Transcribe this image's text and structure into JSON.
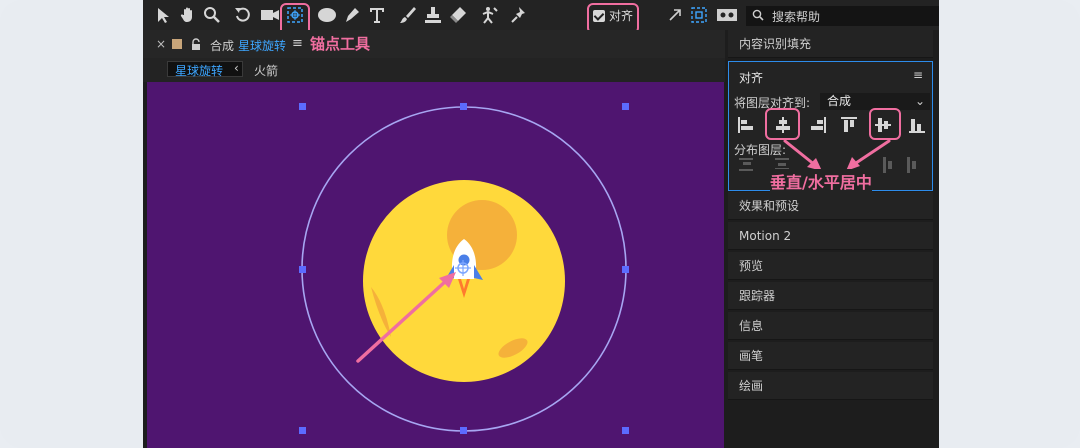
{
  "toolbar": {
    "align_checkbox_label": "对齐",
    "search_label": "搜索帮助",
    "tools": [
      "arrow-icon",
      "hand-icon",
      "zoom-icon",
      "rotate-icon",
      "camera-icon",
      "anchor-point-icon",
      "ellipse-icon",
      "pen-icon",
      "type-icon",
      "brush-icon",
      "clone-stamp-icon",
      "eraser-icon",
      "roto-brush-icon",
      "pin-icon"
    ]
  },
  "composition": {
    "close_glyph": "×",
    "prefix": "合成",
    "name": "星球旋转",
    "menu_glyph": "≡",
    "tabs": [
      "星球旋转",
      "火箭"
    ],
    "tab_arrow": "‹"
  },
  "annotations": {
    "anchor_tool": "锚点工具",
    "align_center": "垂直/水平居中"
  },
  "right_panel": {
    "content_aware_fill": "内容识别填充",
    "align": {
      "title": "对齐",
      "menu_glyph": "≡",
      "align_layers_to_label": "将图层对齐到:",
      "align_target": "合成",
      "distribute_label": "分布图层:"
    },
    "items": [
      "效果和预设",
      "Motion 2",
      "预览",
      "跟踪器",
      "信息",
      "画笔",
      "绘画"
    ]
  },
  "colors": {
    "viewer_bg": "#4f1570",
    "planet": "#ffd93b",
    "crater": "#f5b13a",
    "orbit": "#a7a6f2",
    "annotation": "#f06ea0",
    "tab_blue": "#3ea6ff",
    "panel_focus": "#2d8ceb"
  }
}
